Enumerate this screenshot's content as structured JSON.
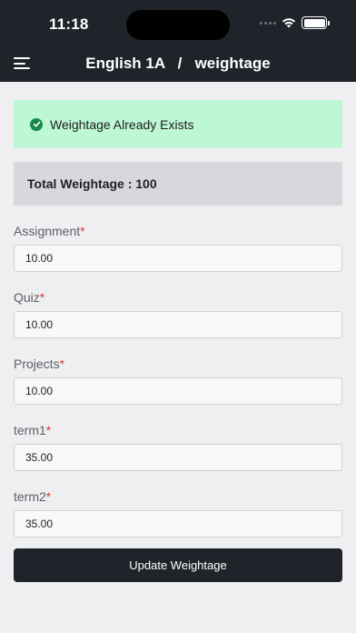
{
  "status_bar": {
    "time": "11:18"
  },
  "header": {
    "course": "English 1A",
    "separator": "/",
    "page": "weightage"
  },
  "alert": {
    "text": "Weightage Already Exists",
    "color": "#bdf7d3"
  },
  "total": {
    "text": "Total Weightage : 100"
  },
  "fields": [
    {
      "label": "Assignment",
      "required": "*",
      "value": "10.00"
    },
    {
      "label": "Quiz",
      "required": "*",
      "value": "10.00"
    },
    {
      "label": "Projects",
      "required": "*",
      "value": "10.00"
    },
    {
      "label": "term1",
      "required": "*",
      "value": "35.00"
    },
    {
      "label": "term2",
      "required": "*",
      "value": "35.00"
    }
  ],
  "actions": {
    "update_label": "Update Weightage"
  },
  "colors": {
    "header_bg": "#1f232a",
    "accent_success": "#1a8a4a",
    "required": "#d63b3b"
  },
  "icons": {
    "menu": "hamburger-menu-icon",
    "alert": "check-circle-icon"
  }
}
